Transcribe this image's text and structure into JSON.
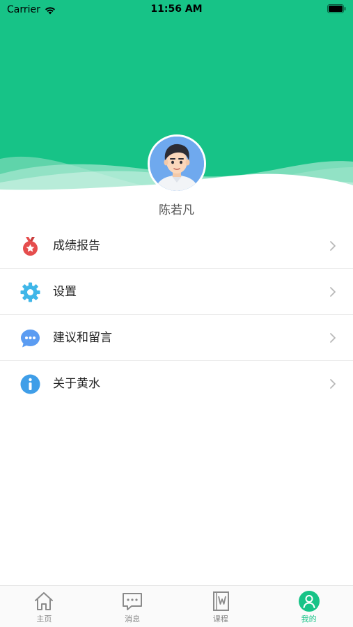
{
  "status_bar": {
    "carrier": "Carrier",
    "time": "11:56 AM"
  },
  "profile": {
    "name": "陈若凡"
  },
  "menu": [
    {
      "label": "成绩报告",
      "icon": "medal-icon"
    },
    {
      "label": "设置",
      "icon": "gear-icon"
    },
    {
      "label": "建议和留言",
      "icon": "chat-bubble-icon"
    },
    {
      "label": "关于黄水",
      "icon": "info-icon"
    }
  ],
  "tabs": [
    {
      "label": "主页",
      "icon": "home-icon",
      "active": false
    },
    {
      "label": "消息",
      "icon": "message-icon",
      "active": false
    },
    {
      "label": "课程",
      "icon": "book-icon",
      "active": false
    },
    {
      "label": "我的",
      "icon": "profile-icon",
      "active": true
    }
  ],
  "colors": {
    "accent": "#17c387",
    "medal_red": "#e54d4d",
    "gear_blue": "#3fb6e8",
    "chat_blue": "#5b9cf2",
    "info_blue": "#3f9ee8"
  }
}
